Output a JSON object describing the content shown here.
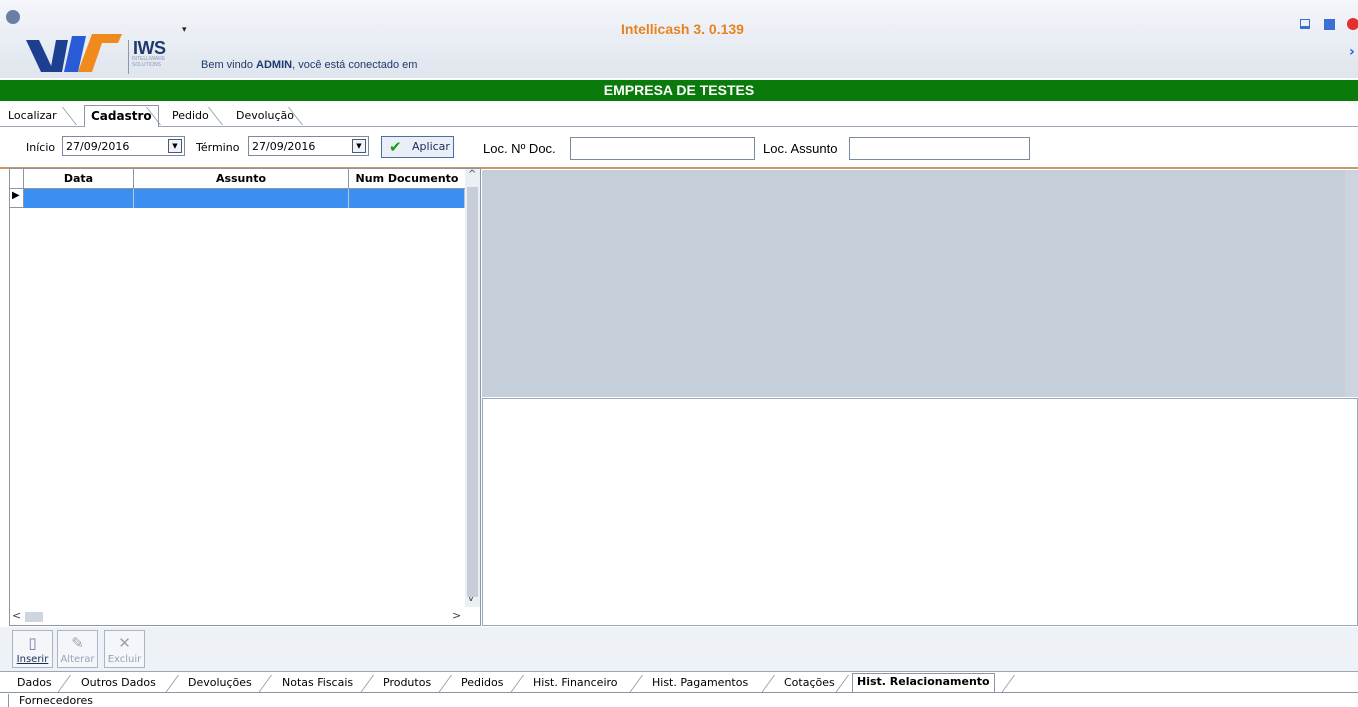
{
  "header": {
    "app_title": "Intellicash 3. 0.139",
    "brand": "IWS",
    "brand_sub": "INTELLIWARE SOLUTIONS",
    "welcome_prefix": "Bem vindo ",
    "welcome_user": "ADMIN",
    "welcome_suffix": ", você está conectado em"
  },
  "company": {
    "name": "EMPRESA DE TESTES"
  },
  "top_tabs": [
    "Localizar",
    "Cadastro",
    "Pedido",
    "Devolução"
  ],
  "top_tabs_active": "Cadastro",
  "filter": {
    "inicio_label": "Início",
    "inicio_value": "27/09/2016",
    "termino_label": "Término",
    "termino_value": "27/09/2016",
    "aplicar_label": "Aplicar",
    "loc_doc_label": "Loc. Nº Doc.",
    "loc_doc_value": "",
    "loc_assunto_label": "Loc. Assunto",
    "loc_assunto_value": ""
  },
  "grid": {
    "columns": [
      "Data",
      "Assunto",
      "Num Documento"
    ],
    "rows": [
      [
        "",
        "",
        ""
      ]
    ]
  },
  "toolbar": {
    "inserir": "Inserir",
    "alterar": "Alterar",
    "excluir": "Excluir"
  },
  "bottom_tabs": [
    "Dados",
    "Outros Dados",
    "Devoluções",
    "Notas Fiscais",
    "Produtos",
    "Pedidos",
    "Hist. Financeiro",
    "Hist. Pagamentos",
    "Cotações",
    "Hist. Relacionamento"
  ],
  "bottom_tabs_active": "Hist. Relacionamento",
  "bottom_tabs_row2": [
    "Fornecedores"
  ],
  "colors": {
    "company_bar": "#0a7b0a",
    "title_orange": "#e8821e",
    "selected_row": "#3b8ff0",
    "panel_gray": "#c5cfd9"
  }
}
